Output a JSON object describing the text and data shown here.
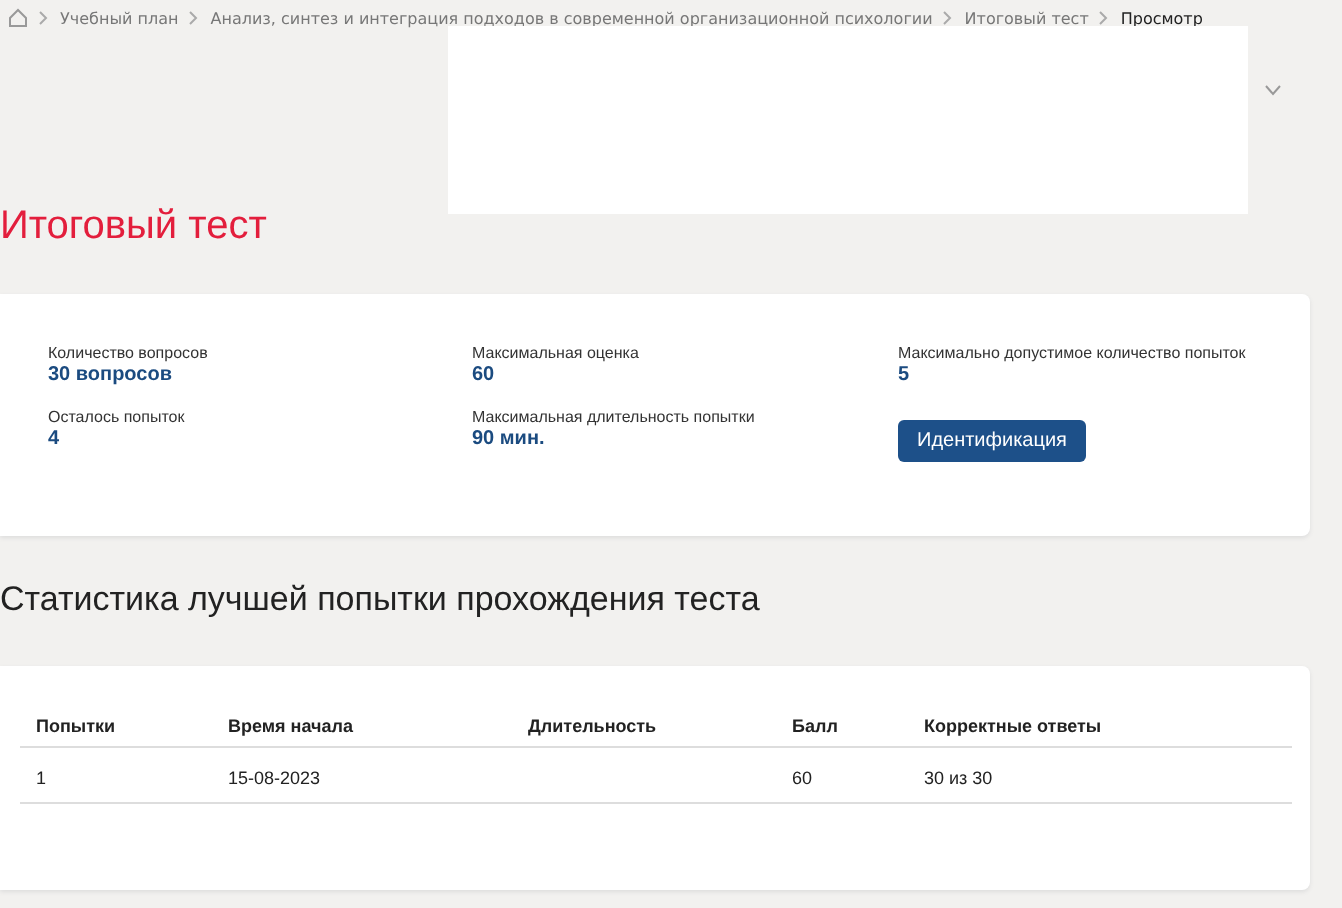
{
  "breadcrumb": [
    {
      "label": "Учебный план",
      "current": false
    },
    {
      "label": "Анализ, синтез и интеграция подходов в современной организационной психологии",
      "current": false
    },
    {
      "label": "Итоговый тест",
      "current": false
    },
    {
      "label": "Просмотр",
      "current": true
    }
  ],
  "title": "Итоговый тест",
  "info": [
    {
      "label": "Количество вопросов",
      "value": "30 вопросов"
    },
    {
      "label": "Максимальная оценка",
      "value": "60"
    },
    {
      "label": "Максимально допустимое количество попыток",
      "value": "5"
    },
    {
      "label": "Осталось попыток",
      "value": "4"
    },
    {
      "label": "Максимальная длительность попытки",
      "value": "90 мин."
    }
  ],
  "identify_button": "Идентификация",
  "stats_title": "Статистика лучшей попытки прохождения теста",
  "table": {
    "columns": [
      "Попытки",
      "Время начала",
      "Длительность",
      "Балл",
      "Корректные ответы"
    ],
    "rows": [
      [
        "1",
        "15-08-2023",
        "",
        "60",
        "30 из 30"
      ]
    ]
  }
}
